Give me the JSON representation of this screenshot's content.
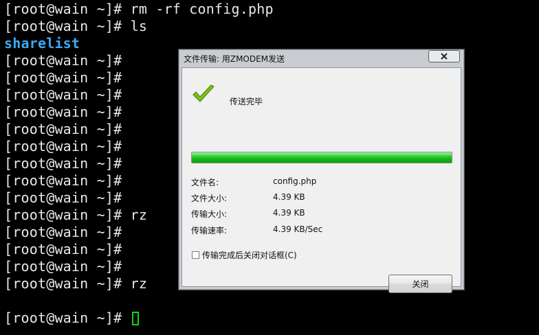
{
  "terminal": {
    "lines": [
      "[root@wain ~]# rm -rf config.php",
      "[root@wain ~]# ls",
      "sharelist",
      "[root@wain ~]#",
      "[root@wain ~]#",
      "[root@wain ~]#",
      "[root@wain ~]#",
      "[root@wain ~]#",
      "[root@wain ~]#",
      "[root@wain ~]#",
      "[root@wain ~]#",
      "[root@wain ~]#",
      "[root@wain ~]# rz",
      "[root@wain ~]#",
      "[root@wain ~]#",
      "[root@wain ~]#",
      "[root@wain ~]# rz",
      "",
      "[root@wain ~]# "
    ]
  },
  "dialog": {
    "title": "文件传输: 用ZMODEM发送",
    "status": "传送完毕",
    "progress_fraction": 1.0,
    "info": [
      {
        "label": "文件名:",
        "value": "config.php"
      },
      {
        "label": "文件大小:",
        "value": "4.39 KB"
      },
      {
        "label": "传输大小:",
        "value": "4.39 KB"
      },
      {
        "label": "传输速率:",
        "value": "4.39 KB/Sec"
      }
    ],
    "auto_close_label": "传输完成后关闭对话框(C)",
    "close_button_label": "关闭"
  },
  "icons": {
    "success": "checkmark-icon",
    "title_close": "close-icon"
  },
  "colors": {
    "directory": "#3fa9f5",
    "cursor": "#14d614",
    "progress": "#16b816",
    "check": "#7cc11a"
  }
}
